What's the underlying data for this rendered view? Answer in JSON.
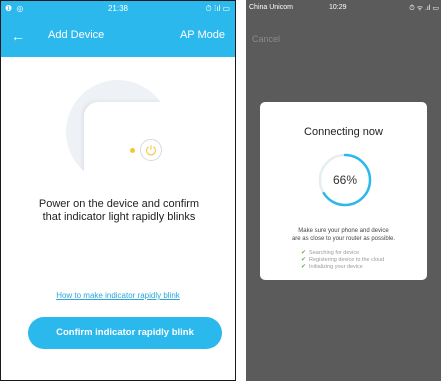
{
  "left": {
    "status": {
      "left_icons": "❶ ◎",
      "time": "21:38",
      "right_icons": "⏱ ⁞ıl ▭"
    },
    "nav": {
      "back_icon": "←",
      "title": "Add Device",
      "ap_mode": "AP Mode"
    },
    "instruction": [
      "Power on the device and confirm",
      "that indicator light rapidly blinks"
    ],
    "help_link": "How to make indicator rapidly blink",
    "confirm_button": "Confirm indicator rapidly blink"
  },
  "right": {
    "status": {
      "carrier": "China Unicom",
      "time": "10:29",
      "right_icons": "⏱ ᯤ .ıl ▭"
    },
    "cancel": "Cancel",
    "modal": {
      "title": "Connecting now",
      "progress": 0.66,
      "progress_label": "66%",
      "description": [
        "Make sure your phone and device",
        "are as close to your router as possible."
      ],
      "steps": [
        "Searching for device",
        "Registering device to the cloud",
        "Initializing your device"
      ]
    }
  },
  "colors": {
    "accent": "#2bb8ec",
    "indicator": "#f2c832",
    "check": "#6ab04c",
    "overlay": "#5b5b5b"
  }
}
